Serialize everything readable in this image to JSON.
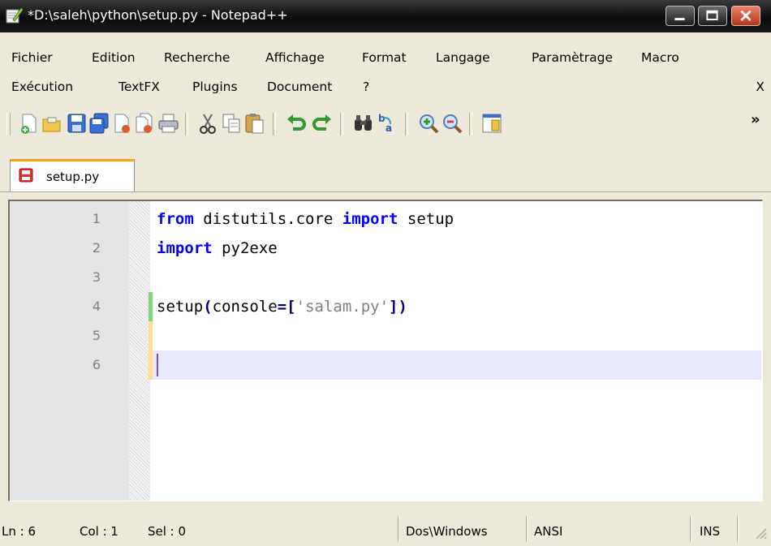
{
  "window": {
    "title": "*D:\\saleh\\python\\setup.py - Notepad++"
  },
  "menu": {
    "row1": [
      "Fichier",
      "Edition",
      "Recherche",
      "Affichage",
      "Format",
      "Langage",
      "Paramètrage",
      "Macro"
    ],
    "row2": [
      "Exécution",
      "TextFX",
      "Plugins",
      "Document",
      "?"
    ],
    "close_label": "X"
  },
  "toolbar": {
    "buttons": [
      "new-file-icon",
      "open-file-icon",
      "save-icon",
      "save-all-icon",
      "close-icon",
      "close-all-icon",
      "print-icon",
      "cut-icon",
      "copy-icon",
      "paste-icon",
      "undo-icon",
      "redo-icon",
      "find-icon",
      "replace-icon",
      "zoom-in-icon",
      "zoom-out-icon",
      "sync-view-icon"
    ],
    "overflow_label": "»"
  },
  "tabs": [
    {
      "label": "setup.py",
      "icon": "unsaved-file-icon",
      "active": true
    }
  ],
  "editor": {
    "lines": [
      {
        "num": "1",
        "tokens": [
          [
            "kw",
            "from"
          ],
          [
            "t",
            " distutils.core "
          ],
          [
            "kw",
            "import"
          ],
          [
            "t",
            " setup"
          ]
        ]
      },
      {
        "num": "2",
        "tokens": [
          [
            "kw",
            "import"
          ],
          [
            "t",
            " py2exe"
          ]
        ]
      },
      {
        "num": "3",
        "tokens": []
      },
      {
        "num": "4",
        "tokens": [
          [
            "t",
            "setup"
          ],
          [
            "op",
            "("
          ],
          [
            "t",
            "console"
          ],
          [
            "op",
            "=["
          ],
          [
            "str",
            "'salam.py'"
          ],
          [
            "op",
            "])"
          ]
        ]
      },
      {
        "num": "5",
        "tokens": []
      },
      {
        "num": "6",
        "tokens": []
      }
    ],
    "current_line": 6,
    "saved_change_color": "#7ed67e",
    "unsaved_change_color": "#ffe08a"
  },
  "status": {
    "ln": "Ln : 6",
    "col": "Col : 1",
    "sel": "Sel : 0",
    "eol": "Dos\\Windows",
    "encoding": "ANSI",
    "mode": "INS"
  },
  "colors": {
    "keyword": "#0000ff",
    "operator": "#000080",
    "string": "#808080",
    "current_line_bg": "#e8e8ff",
    "tab_accent": "#f8a41a"
  }
}
